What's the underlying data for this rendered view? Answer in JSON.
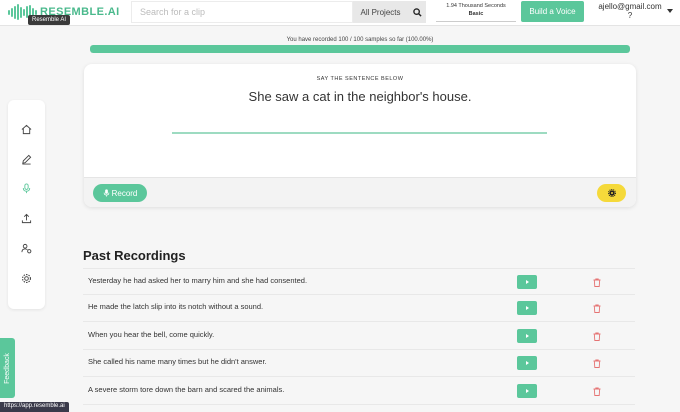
{
  "header": {
    "brand": "RESEMBLE.AI",
    "brand_tooltip": "Resemble AI",
    "search_placeholder": "Search for a clip",
    "projects_label": "All Projects",
    "credits_amount": "1.94 Thousand Seconds",
    "credits_plan": "Basic",
    "build_voice_label": "Build a Voice",
    "user_email": "ajello@gmail.com",
    "user_extra": "?"
  },
  "progress": {
    "text": "You have recorded 100 / 100 samples so far (100.00%)",
    "percent": 100
  },
  "sidebar": {
    "items": [
      {
        "icon": "home-icon"
      },
      {
        "icon": "pencil-icon"
      },
      {
        "icon": "microphone-icon"
      },
      {
        "icon": "upload-icon"
      },
      {
        "icon": "user-settings-icon"
      },
      {
        "icon": "gear-icon"
      }
    ]
  },
  "card": {
    "label": "SAY THE SENTENCE BELOW",
    "sentence": "She saw a cat in the neighbor's house.",
    "record_label": "Record"
  },
  "past": {
    "title": "Past Recordings",
    "rows": [
      {
        "text": "Yesterday he had asked her to marry him and she had consented."
      },
      {
        "text": "He made the latch slip into its notch without a sound."
      },
      {
        "text": "When you hear the bell, come quickly."
      },
      {
        "text": "She called his name many times but he didn't answer."
      },
      {
        "text": "A severe storm tore down the barn and scared the animals."
      }
    ]
  },
  "feedback_label": "Feedback",
  "status_url": "https://app.resemble.ai",
  "colors": {
    "accent": "#5bc79b",
    "settings": "#f5d93a",
    "delete": "#e57373"
  }
}
